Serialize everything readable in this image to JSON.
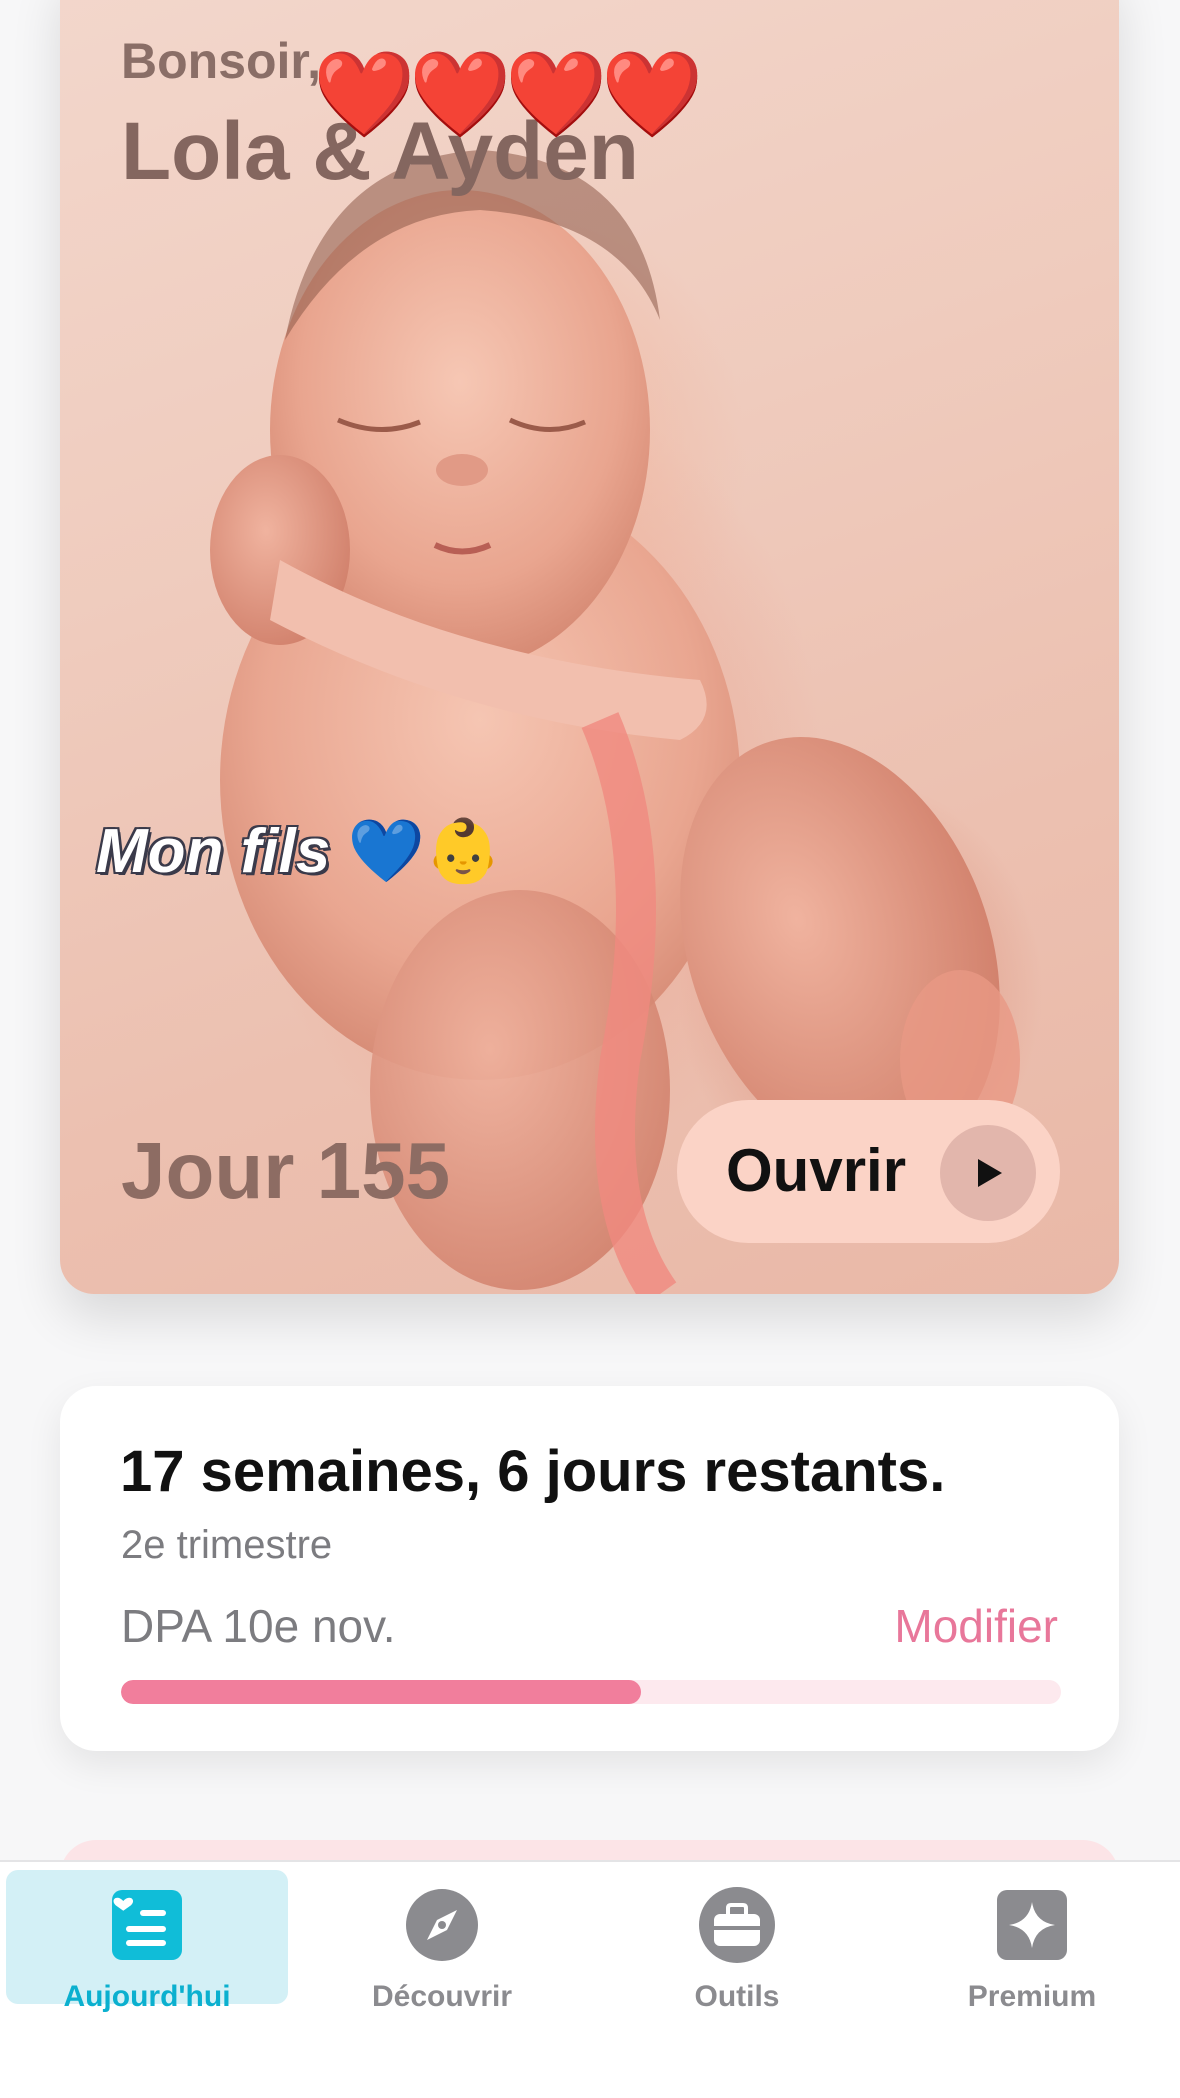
{
  "hero": {
    "greeting": "Bonsoir,",
    "name": "Lola & Ayden",
    "sticker_hearts": "❤️❤️❤️❤️",
    "caption_text": "Mon fils",
    "caption_emojis": [
      "💙",
      "👶"
    ],
    "day_label": "Jour 155",
    "open_button_label": "Ouvrir",
    "play_icon": "play-icon"
  },
  "progress": {
    "remaining": "17 semaines, 6 jours restants.",
    "trimester": "2e trimestre",
    "due_date": "DPA 10e nov.",
    "edit_label": "Modifier",
    "progress_fraction": 0.553
  },
  "tabs": [
    {
      "label": "Aujourd'hui",
      "icon": "today-icon",
      "active": true
    },
    {
      "label": "Découvrir",
      "icon": "compass-icon",
      "active": false
    },
    {
      "label": "Outils",
      "icon": "briefcase-icon",
      "active": false
    },
    {
      "label": "Premium",
      "icon": "sparkle-icon",
      "active": false
    }
  ],
  "colors": {
    "accent_pink": "#f17e9c",
    "accent_cyan": "#0bb0cf",
    "button_peach": "#fbd3c6",
    "text_dark": "#111111",
    "text_gray": "#7c7c80"
  }
}
